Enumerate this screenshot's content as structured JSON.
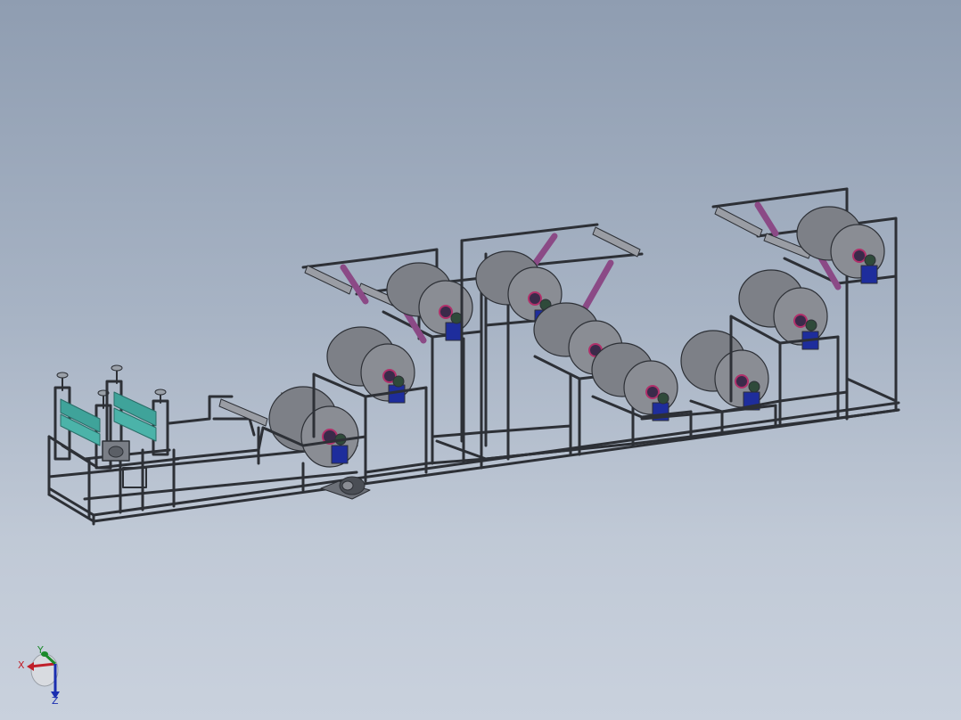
{
  "viewport": {
    "background_top": "#8f9db1",
    "background_bottom": "#c9d1dd"
  },
  "model": {
    "frame_color": "#2d3036",
    "roller_color": "#8a8d94",
    "roller_shadow": "#5f6269",
    "feed_roller_color": "#3fa39a",
    "tension_arm_color": "#8b4a86",
    "motor_color": "#1e2d9c",
    "hub_color": "#b0306a"
  },
  "triad": {
    "x_label": "X",
    "y_label": "Y",
    "z_label": "Z",
    "x_color": "#c0202a",
    "y_color": "#1b8a2a",
    "z_color": "#1a2eb0"
  }
}
